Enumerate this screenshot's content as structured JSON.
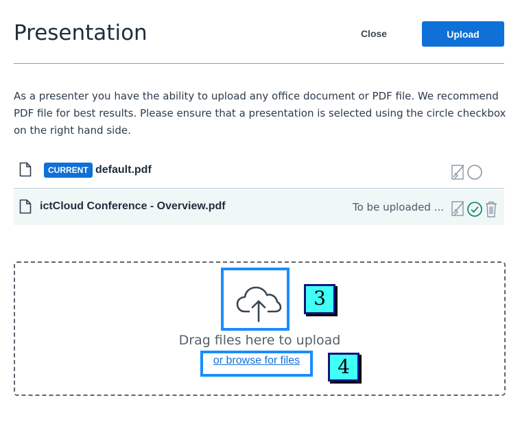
{
  "dialog": {
    "title": "Presentation",
    "close_label": "Close",
    "upload_label": "Upload",
    "description": "As a presenter you have the ability to upload any office document or PDF file. We recommend PDF file for best results. Please ensure that a presentation is selected using the circle checkbox on the right hand side."
  },
  "files": [
    {
      "badge": "CURRENT",
      "name": "default.pdf",
      "status": "",
      "selected": false,
      "icons": [
        "document-icon",
        "download-toggle-icon",
        "select-circle-icon"
      ]
    },
    {
      "badge": "",
      "name": "ictCloud Conference - Overview.pdf",
      "status": "To be uploaded ...",
      "selected": true,
      "icons": [
        "document-icon",
        "download-toggle-icon",
        "selected-check-icon",
        "trash-icon"
      ]
    }
  ],
  "dropzone": {
    "icon": "cloud-upload-icon",
    "label": "Drag files here to upload",
    "browse_label": "or browse for files"
  },
  "annotations": {
    "marker_3": "3",
    "marker_4": "4"
  },
  "colors": {
    "primary": "#0f70d7",
    "highlight_box": "#1a8cff",
    "marker_fill": "#3ffff6",
    "selected_check": "#1e8a6e"
  }
}
